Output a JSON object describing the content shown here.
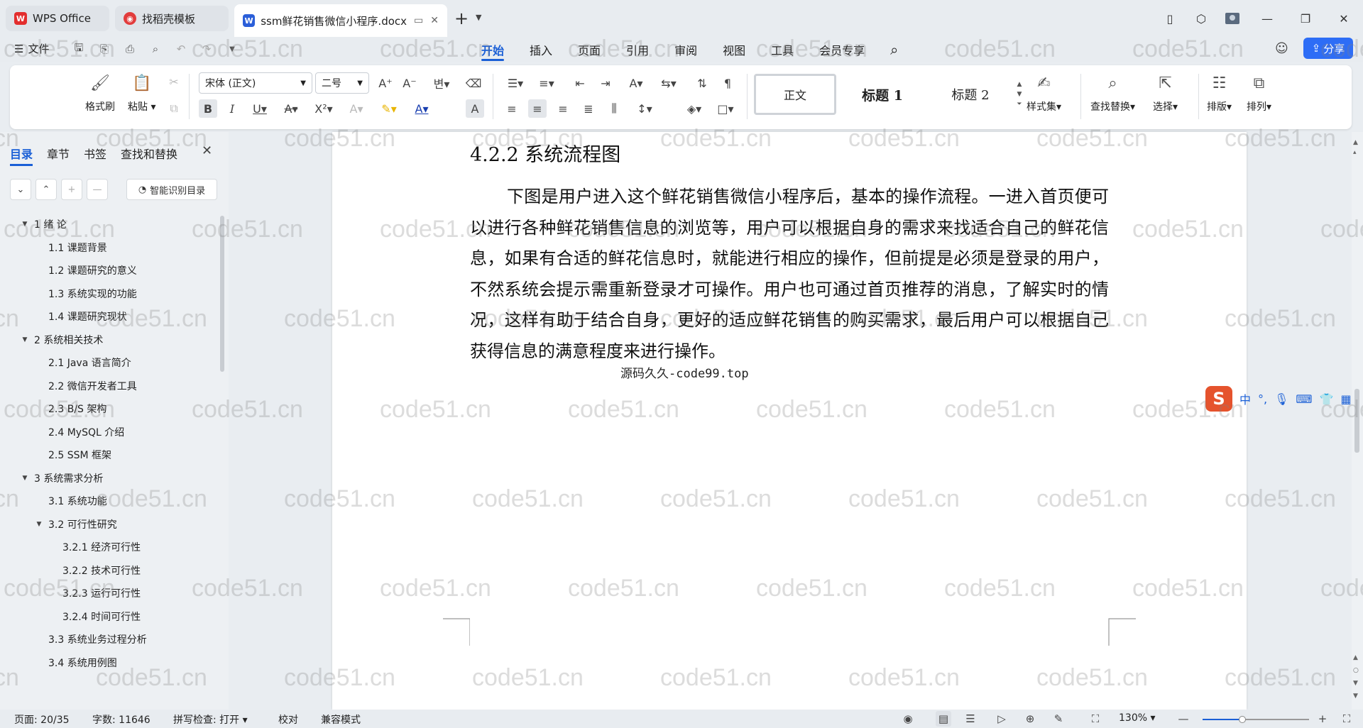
{
  "window": {
    "tabs": [
      {
        "label": "WPS Office",
        "icon": "wps-logo-icon",
        "color": "#e32e2e"
      },
      {
        "label": "找稻壳模板",
        "icon": "docer-icon",
        "color": "#e23c3c"
      },
      {
        "label": "ssm鲜花销售微信小程序.docx",
        "icon": "word-doc-icon",
        "color": "#2b5fd9"
      }
    ],
    "new_tab": "+"
  },
  "menu": {
    "file_label": "文件",
    "tabs": [
      "开始",
      "插入",
      "页面",
      "引用",
      "审阅",
      "视图",
      "工具",
      "会员专享"
    ],
    "active_tab": "开始",
    "share_label": "分享"
  },
  "ribbon": {
    "format_painter": "格式刷",
    "paste": "粘贴",
    "font_name": "宋体 (正文)",
    "font_size": "二号",
    "styles": [
      "正文",
      "标题 1",
      "标题 2"
    ],
    "style_set": "样式集",
    "find_replace": "查找替换",
    "select": "选择",
    "layout": "排版",
    "arrange": "排列"
  },
  "nav": {
    "tabs": [
      "目录",
      "章节",
      "书签",
      "查找和替换"
    ],
    "active_tab": "目录",
    "smart_toc": "智能识别目录",
    "toc": [
      {
        "label": "1 绪  论",
        "level": 0,
        "expanded": true
      },
      {
        "label": "1.1  课题背景",
        "level": 1
      },
      {
        "label": "1.2  课题研究的意义",
        "level": 1
      },
      {
        "label": "1.3  系统实现的功能",
        "level": 1
      },
      {
        "label": "1.4  课题研究现状",
        "level": 1
      },
      {
        "label": "2 系统相关技术",
        "level": 0,
        "expanded": true
      },
      {
        "label": "2.1 Java 语言简介",
        "level": 1
      },
      {
        "label": "2.2 微信开发者工具",
        "level": 1
      },
      {
        "label": "2.3 B/S 架构",
        "level": 1
      },
      {
        "label": "2.4 MySQL  介绍",
        "level": 1
      },
      {
        "label": "2.5 SSM 框架",
        "level": 1
      },
      {
        "label": "3 系统需求分析",
        "level": 0,
        "expanded": true
      },
      {
        "label": "3.1 系统功能",
        "level": 1
      },
      {
        "label": "3.2 可行性研究",
        "level": 1,
        "expanded": true
      },
      {
        "label": "3.2.1  经济可行性",
        "level": 2
      },
      {
        "label": "3.2.2  技术可行性",
        "level": 2
      },
      {
        "label": "3.2.3  运行可行性",
        "level": 2
      },
      {
        "label": "3.2.4  时间可行性",
        "level": 2
      },
      {
        "label": "3.3 系统业务过程分析",
        "level": 1
      },
      {
        "label": "3.4 系统用例图",
        "level": 1
      }
    ]
  },
  "document": {
    "heading": "4.2.2 系统流程图",
    "paragraph": "下图是用户进入这个鲜花销售微信小程序后，基本的操作流程。一进入首页便可以进行各种鲜花销售信息的浏览等，用户可以根据自身的需求来找适合自己的鲜花信息，如果有合适的鲜花信息时，就能进行相应的操作，但前提是必须是登录的用户，不然系统会提示需重新登录才可操作。用户也可通过首页推荐的消息，了解实时的情况，这样有助于结合自身，更好的适应鲜花销售的购买需求，最后用户可以根据自己获得信息的满意程度来进行操作。",
    "caption": "源码久久-code99.top",
    "watermark": "code51.cn"
  },
  "ime": {
    "logo": "S",
    "mode": "中",
    "punct": "°,"
  },
  "status": {
    "page": "页面: 20/35",
    "words": "字数: 11646",
    "spell": "拼写检查: 打开",
    "proof": "校对",
    "compat": "兼容模式",
    "zoom": "130%",
    "zoom_level": 0.37
  },
  "colors": {
    "accent": "#1a5fd6",
    "share": "#2d6df6",
    "wps_red": "#e32e2e"
  }
}
